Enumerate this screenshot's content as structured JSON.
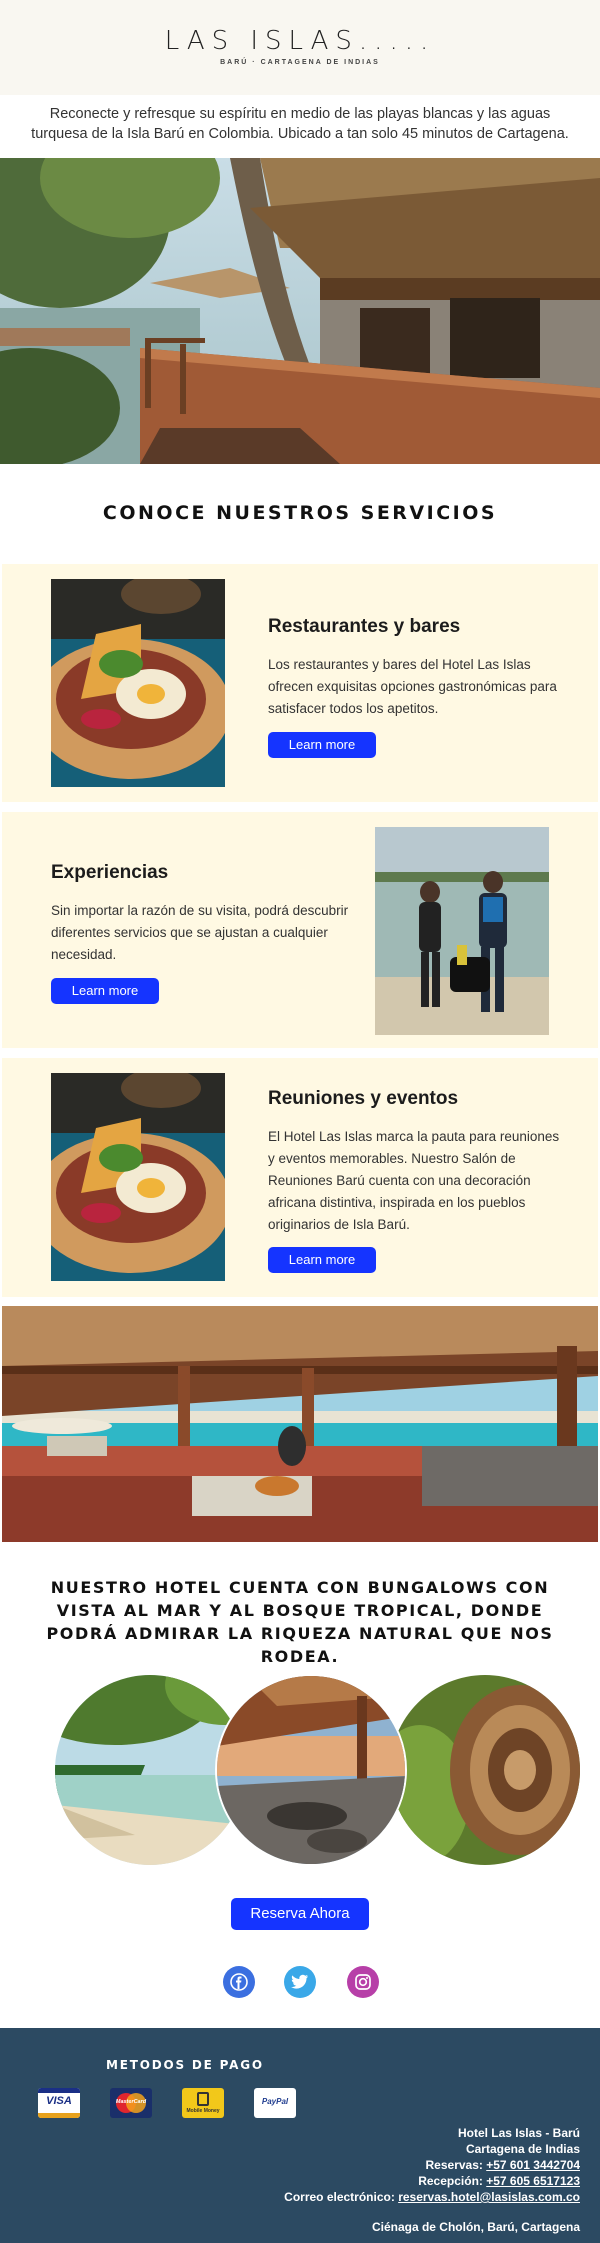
{
  "header": {
    "logo_text": "LAS ISLAS.....",
    "logo_subtitle": "BARÚ · CARTAGENA DE INDIAS"
  },
  "intro": "Reconecte y refresque su espíritu en medio de las playas blancas y las aguas turquesa de la Isla Barú en Colombia. Ubicado a tan solo 45 minutos de Cartagena.",
  "services_title": "CONOCE NUESTROS SERVICIOS",
  "services": [
    {
      "title": "Restaurantes y bares",
      "description": "Los restaurantes y bares del Hotel Las Islas ofrecen exquisitas opciones gastronómicas para satisfacer todos los apetitos.",
      "button": "Learn more"
    },
    {
      "title": "Experiencias",
      "description": "Sin importar la razón de su visita, podrá descubrir diferentes servicios que se ajustan a cualquier necesidad.",
      "button": "Learn more"
    },
    {
      "title": "Reuniones y eventos",
      "description": "El Hotel Las Islas marca la pauta para reuniones y eventos memorables. Nuestro Salón de Reuniones Barú cuenta con una decoración africana distintiva, inspirada en los pueblos originarios de Isla Barú.",
      "button": "Learn more"
    }
  ],
  "bungalow_text": "NUESTRO HOTEL CUENTA CON BUNGALOWS CON VISTA AL MAR  Y AL BOSQUE TROPICAL, DONDE PODRÁ ADMIRAR LA RIQUEZA NATURAL QUE NOS RODEA.",
  "reserve_button": "Reserva Ahora",
  "social": [
    "facebook-icon",
    "twitter-icon",
    "instagram-icon"
  ],
  "footer": {
    "payment_title": "METODOS DE PAGO",
    "payment_methods": [
      {
        "label": "VISA"
      },
      {
        "label": "MasterCard"
      },
      {
        "label": "Mobile Money"
      },
      {
        "label": "PayPal"
      }
    ],
    "hotel_name": "Hotel Las Islas - Barú",
    "city": "Cartagena de Indias",
    "reservations_label": "Reservas: ",
    "reservations_phone": "+57 601 3442704",
    "reception_label": "Recepción: ",
    "reception_phone": "+57 605 6517123",
    "email_label": "Correo electrónico: ",
    "email": "reservas.hotel@lasislas.com.co",
    "address": "Ciénaga de Cholón, Barú, Cartagena"
  },
  "colors": {
    "accent_blue": "#1534ff",
    "service_bg": "#fff9e3",
    "header_bg": "#f9f7f1",
    "footer_bg": "#2c4a62"
  }
}
